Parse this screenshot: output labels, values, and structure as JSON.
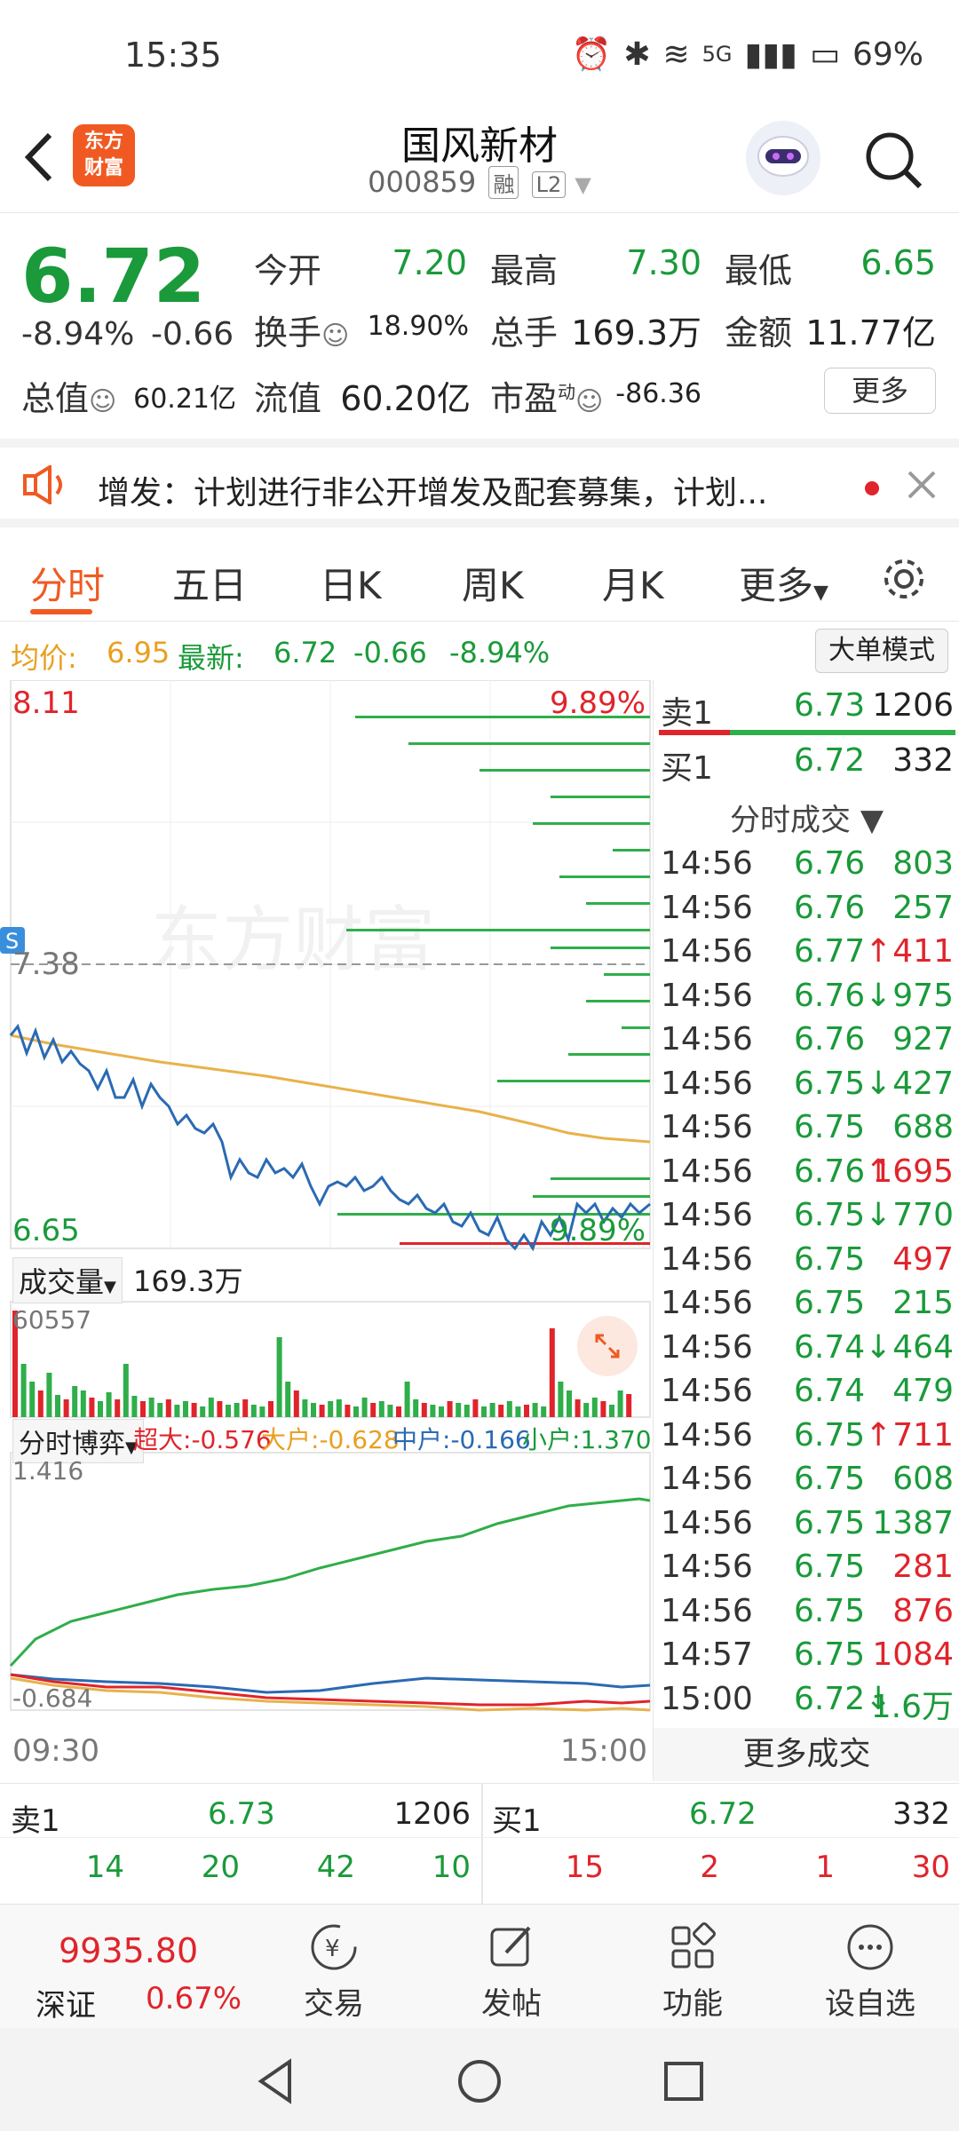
{
  "status": {
    "time": "15:35",
    "network": "5G",
    "battery": "69%"
  },
  "header": {
    "logo": "东方财富",
    "title": "国风新材",
    "code": "000859",
    "tag_rong": "融",
    "tag_l2": "L2"
  },
  "quote": {
    "price": "6.72",
    "change_pct": "-8.94%",
    "change": "-0.66",
    "open_label": "今开",
    "open": "7.20",
    "high_label": "最高",
    "high": "7.30",
    "low_label": "最低",
    "low": "6.65",
    "turnover_label": "换手",
    "turnover": "18.90%",
    "volume_label": "总手",
    "volume": "169.3万",
    "amount_label": "金额",
    "amount": "11.77亿",
    "mcap_label": "总值",
    "mcap": "60.21亿",
    "float_label": "流值",
    "float": "60.20亿",
    "pe_label": "市盈",
    "pe_sup": "动",
    "pe": "-86.36",
    "more": "更多"
  },
  "notice": {
    "text": "增发：计划进行非公开增发及配套募集，计划..."
  },
  "tabs": [
    "分时",
    "五日",
    "日K",
    "周K",
    "月K",
    "更多"
  ],
  "infoline": {
    "avg_label": "均价:",
    "avg": "6.95",
    "latest_label": "最新:",
    "latest": "6.72",
    "chg": "-0.66",
    "pct": "-8.94%",
    "mode_button": "大单模式"
  },
  "chart": {
    "top_price": "8.11",
    "top_pct": "9.89%",
    "ref_price": "7.38",
    "bottom_price": "6.65",
    "bottom_pct": "9.89%",
    "volume_label": "成交量",
    "volume_total": "169.3万",
    "volume_max": "60557",
    "flow_label": "分时博弈",
    "flow_super_label": "超大:",
    "flow_super": "-0.576",
    "flow_big_label": "大户:",
    "flow_big": "-0.628",
    "flow_mid_label": "中户:",
    "flow_mid": "-0.166",
    "flow_small_label": "小户:",
    "flow_small": "1.370",
    "flow_top": "1.416",
    "flow_bottom": "-0.684",
    "time_start": "09:30",
    "time_end": "15:00",
    "watermark": "东方财富"
  },
  "orderbook_top": {
    "sell_label": "卖1",
    "sell_price": "6.73",
    "sell_vol": "1206",
    "buy_label": "买1",
    "buy_price": "6.72",
    "buy_vol": "332"
  },
  "trades_header": "分时成交",
  "trades": [
    {
      "t": "14:56",
      "p": "6.76",
      "arrow": "",
      "v": "803",
      "vc": "green"
    },
    {
      "t": "14:56",
      "p": "6.76",
      "arrow": "",
      "v": "257",
      "vc": "green"
    },
    {
      "t": "14:56",
      "p": "6.77",
      "arrow": "↑",
      "v": "411",
      "vc": "red"
    },
    {
      "t": "14:56",
      "p": "6.76",
      "arrow": "↓",
      "v": "975",
      "vc": "green"
    },
    {
      "t": "14:56",
      "p": "6.76",
      "arrow": "",
      "v": "927",
      "vc": "green"
    },
    {
      "t": "14:56",
      "p": "6.75",
      "arrow": "↓",
      "v": "427",
      "vc": "green"
    },
    {
      "t": "14:56",
      "p": "6.75",
      "arrow": "",
      "v": "688",
      "vc": "green"
    },
    {
      "t": "14:56",
      "p": "6.76",
      "arrow": "↑",
      "v": "1695",
      "vc": "red"
    },
    {
      "t": "14:56",
      "p": "6.75",
      "arrow": "↓",
      "v": "770",
      "vc": "green"
    },
    {
      "t": "14:56",
      "p": "6.75",
      "arrow": "",
      "v": "497",
      "vc": "red"
    },
    {
      "t": "14:56",
      "p": "6.75",
      "arrow": "",
      "v": "215",
      "vc": "green"
    },
    {
      "t": "14:56",
      "p": "6.74",
      "arrow": "↓",
      "v": "464",
      "vc": "green"
    },
    {
      "t": "14:56",
      "p": "6.74",
      "arrow": "",
      "v": "479",
      "vc": "green"
    },
    {
      "t": "14:56",
      "p": "6.75",
      "arrow": "↑",
      "v": "711",
      "vc": "red"
    },
    {
      "t": "14:56",
      "p": "6.75",
      "arrow": "",
      "v": "608",
      "vc": "green"
    },
    {
      "t": "14:56",
      "p": "6.75",
      "arrow": "",
      "v": "1387",
      "vc": "green"
    },
    {
      "t": "14:56",
      "p": "6.75",
      "arrow": "",
      "v": "281",
      "vc": "red"
    },
    {
      "t": "14:56",
      "p": "6.75",
      "arrow": "",
      "v": "876",
      "vc": "red"
    },
    {
      "t": "14:57",
      "p": "6.75",
      "arrow": "",
      "v": "1084",
      "vc": "red"
    },
    {
      "t": "15:00",
      "p": "6.72",
      "arrow": "↓",
      "v": "1.6万",
      "vc": "green"
    }
  ],
  "more_trades": "更多成交",
  "book": {
    "sell_label": "卖1",
    "sell_price": "6.73",
    "sell_vol": "1206",
    "buy_label": "买1",
    "buy_price": "6.72",
    "buy_vol": "332",
    "sell_row": [
      "14",
      "20",
      "42",
      "10"
    ],
    "buy_row": [
      "15",
      "2",
      "1",
      "30"
    ]
  },
  "bottombar": {
    "index_value": "9935.80",
    "index_name": "深证",
    "index_pct": "0.67%",
    "trade": "交易",
    "post": "发帖",
    "func": "功能",
    "watch": "设自选"
  },
  "colors": {
    "accent": "#f05a22",
    "up": "#e0242b",
    "down": "#1a9a3a",
    "price_line": "#2a6ab3",
    "avg_line": "#e8b24a"
  }
}
